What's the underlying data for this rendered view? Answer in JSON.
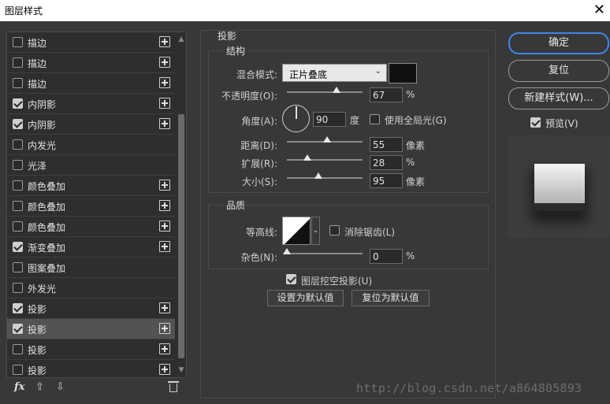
{
  "window": {
    "title": "图层样式",
    "close": "✕"
  },
  "styles_list": {
    "items": [
      {
        "label": "描边",
        "checked": false,
        "has_plus": true
      },
      {
        "label": "描边",
        "checked": false,
        "has_plus": true
      },
      {
        "label": "描边",
        "checked": false,
        "has_plus": true
      },
      {
        "label": "内阴影",
        "checked": true,
        "has_plus": true
      },
      {
        "label": "内阴影",
        "checked": true,
        "has_plus": true
      },
      {
        "label": "内发光",
        "checked": false,
        "has_plus": false
      },
      {
        "label": "光泽",
        "checked": false,
        "has_plus": false
      },
      {
        "label": "颜色叠加",
        "checked": false,
        "has_plus": true
      },
      {
        "label": "颜色叠加",
        "checked": false,
        "has_plus": true
      },
      {
        "label": "颜色叠加",
        "checked": false,
        "has_plus": true
      },
      {
        "label": "渐变叠加",
        "checked": true,
        "has_plus": true
      },
      {
        "label": "图案叠加",
        "checked": false,
        "has_plus": false
      },
      {
        "label": "外发光",
        "checked": false,
        "has_plus": false
      },
      {
        "label": "投影",
        "checked": true,
        "has_plus": true
      },
      {
        "label": "投影",
        "checked": true,
        "has_plus": true,
        "selected": true
      },
      {
        "label": "投影",
        "checked": false,
        "has_plus": true
      },
      {
        "label": "投影",
        "checked": false,
        "has_plus": true
      }
    ],
    "footer": {
      "fx": "fx",
      "up": "⇧",
      "down": "⇩",
      "trash": "trash-icon"
    }
  },
  "drop_shadow": {
    "section_title": "投影",
    "structure": {
      "title": "结构",
      "blend_mode_label": "混合模式:",
      "blend_mode_value": "正片叠底",
      "shadow_color": "#111111",
      "opacity_label": "不透明度(O):",
      "opacity_value": "67",
      "opacity_unit": "%",
      "angle_label": "角度(A):",
      "angle_value": "90",
      "angle_unit": "度",
      "global_light_label": "使用全局光(G)",
      "global_light_checked": false,
      "distance_label": "距离(D):",
      "distance_value": "55",
      "distance_unit": "像素",
      "spread_label": "扩展(R):",
      "spread_value": "28",
      "spread_unit": "%",
      "size_label": "大小(S):",
      "size_value": "95",
      "size_unit": "像素"
    },
    "quality": {
      "title": "品质",
      "contour_label": "等高线:",
      "anti_alias_label": "消除锯齿(L)",
      "anti_alias_checked": false,
      "noise_label": "杂色(N):",
      "noise_value": "0",
      "noise_unit": "%"
    },
    "knockout_label": "图层挖空投影(U)",
    "knockout_checked": true,
    "make_default_label": "设置为默认值",
    "reset_default_label": "复位为默认值"
  },
  "actions": {
    "ok_label": "确定",
    "reset_label": "复位",
    "new_style_label": "新建样式(W)...",
    "preview_label": "预览(V)",
    "preview_checked": true
  },
  "watermark": "http://blog.csdn.net/a864805893",
  "colors": {
    "accent": "#3d86e6",
    "bg": "#383838"
  }
}
